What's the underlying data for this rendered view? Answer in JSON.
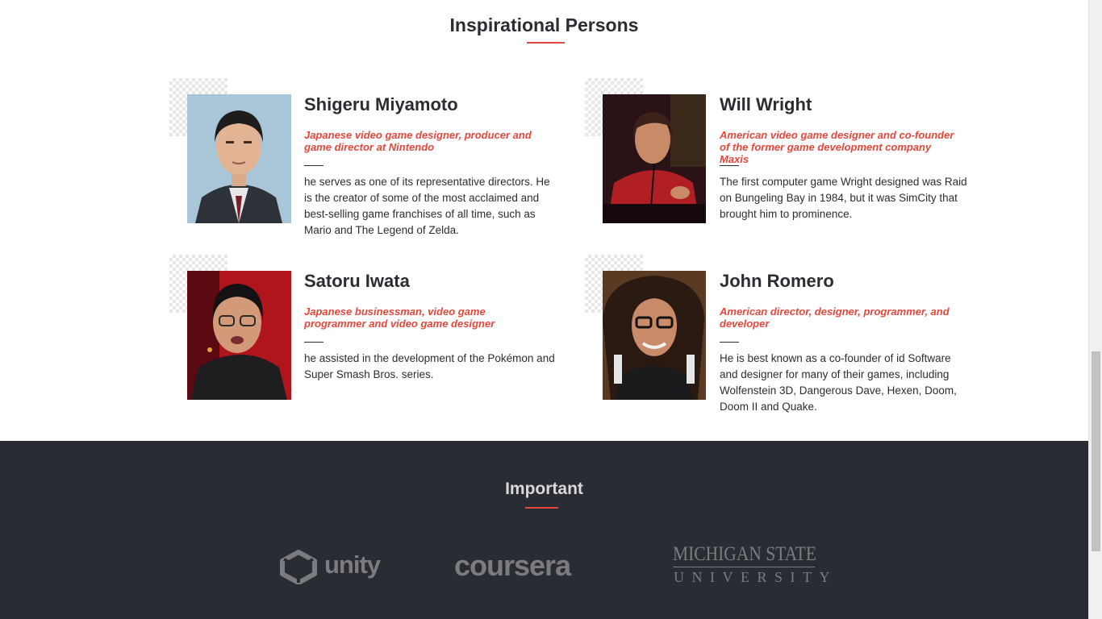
{
  "inspirational": {
    "title": "Inspirational Persons",
    "persons": [
      {
        "name": "Shigeru Miyamoto",
        "role": "Japanese video game designer, producer and game director at Nintendo",
        "description": "he serves as one of its representative directors. He is the creator of some of the most acclaimed and best-selling game franchises of all time, such as Mario and The Legend of Zelda."
      },
      {
        "name": "Will Wright",
        "role": "American video game designer and co-founder of the former game development company Maxis",
        "description": "The first computer game Wright designed was Raid on Bungeling Bay in 1984, but it was SimCity that brought him to prominence."
      },
      {
        "name": "Satoru Iwata",
        "role": "Japanese businessman, video game programmer and video game designer",
        "description": "he assisted in the development of the Pokémon and Super Smash Bros. series."
      },
      {
        "name": "John Romero",
        "role": "American director, designer, programmer, and developer",
        "description": "He is best known as a co-founder of id Software and designer for many of their games, including Wolfenstein 3D, Dangerous Dave, Hexen, Doom, Doom II and Quake."
      }
    ]
  },
  "important": {
    "title": "Important",
    "logos": [
      {
        "text": "unity",
        "icon": "unity-logo-icon"
      },
      {
        "text": "coursera",
        "icon": "coursera-logo"
      },
      {
        "line1": "MICHIGAN STATE",
        "line2": "UNIVERSITY",
        "icon": "msu-logo"
      }
    ]
  },
  "colors": {
    "accent": "#e5473b",
    "footer_bg": "#2a2c33",
    "text": "#2b2d33"
  }
}
